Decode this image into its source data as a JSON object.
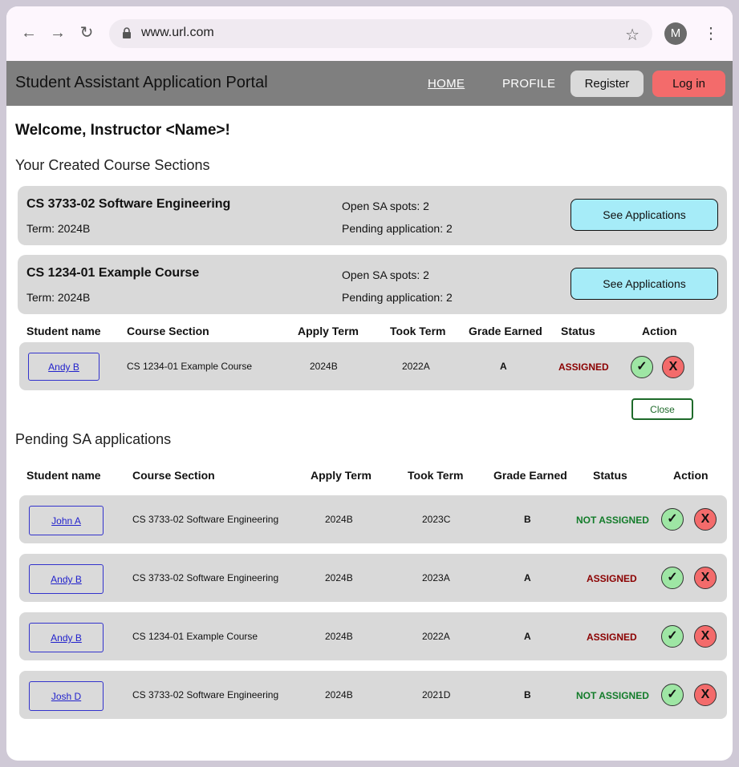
{
  "browser": {
    "url": "www.url.com",
    "avatar_letter": "M"
  },
  "header": {
    "title": "Student Assistant Application Portal",
    "nav_home": "HOME",
    "nav_profile": "PROFILE",
    "register_label": "Register",
    "login_label": "Log in"
  },
  "welcome": "Welcome, Instructor <Name>!",
  "sections_heading": "Your Created Course Sections",
  "courses": [
    {
      "name": "CS 3733-02 Software Engineering",
      "term": "Term: 2024B",
      "open_spots": "Open SA spots: 2",
      "pending": "Pending application: 2",
      "button": "See Applications"
    },
    {
      "name": "CS 1234-01 Example Course",
      "term": "Term: 2024B",
      "open_spots": "Open SA spots: 2",
      "pending": "Pending application: 2",
      "button": "See Applications"
    }
  ],
  "columns": [
    "Student name",
    "Course Section",
    "Apply Term",
    "Took Term",
    "Grade Earned",
    "Status",
    "Action"
  ],
  "course_applications": [
    {
      "student": "Andy B",
      "section": "CS 1234-01 Example Course",
      "apply_term": "2024B",
      "took_term": "2022A",
      "grade": "A",
      "status": "ASSIGNED"
    }
  ],
  "close_label": "Close",
  "pending_heading": "Pending SA applications",
  "pending_applications": [
    {
      "student": "John A",
      "section": "CS 3733-02 Software Engineering",
      "apply_term": "2024B",
      "took_term": "2023C",
      "grade": "B",
      "status": "NOT ASSIGNED"
    },
    {
      "student": "Andy B",
      "section": "CS 3733-02 Software Engineering",
      "apply_term": "2024B",
      "took_term": "2023A",
      "grade": "A",
      "status": "ASSIGNED"
    },
    {
      "student": "Andy B",
      "section": "CS 1234-01 Example Course",
      "apply_term": "2024B",
      "took_term": "2022A",
      "grade": "A",
      "status": "ASSIGNED"
    },
    {
      "student": "Josh D",
      "section": "CS 3733-02 Software Engineering",
      "apply_term": "2024B",
      "took_term": "2021D",
      "grade": "B",
      "status": "NOT ASSIGNED"
    }
  ],
  "action_icons": {
    "accept": "✓",
    "reject": "X"
  },
  "colors": {
    "assigned": "#8b0000",
    "not_assigned": "#137c2a",
    "accept": "#9ee6a4",
    "reject": "#f36b6b",
    "see_applications": "#a6ecf8"
  }
}
